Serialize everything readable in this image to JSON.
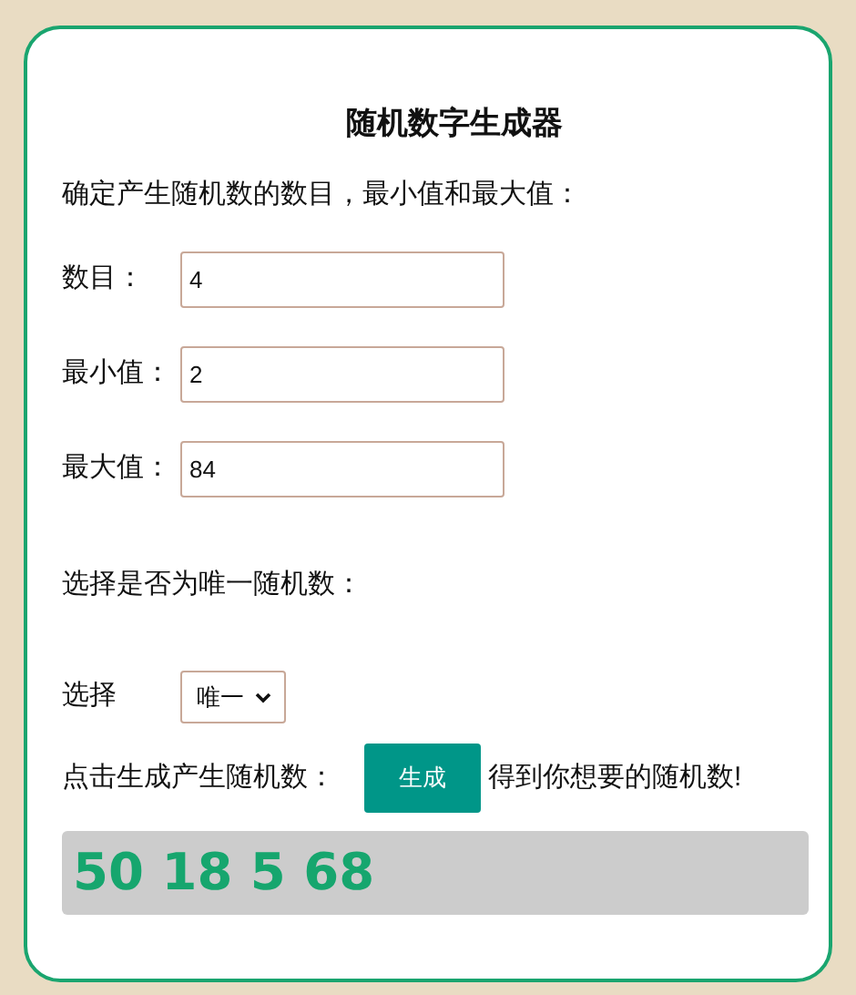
{
  "title": "随机数字生成器",
  "intro": "确定产生随机数的数目，最小值和最大值：",
  "fields": [
    {
      "label": "数目：",
      "value": "4"
    },
    {
      "label": "最小值：",
      "value": "2"
    },
    {
      "label": "最大值：",
      "value": "84"
    }
  ],
  "unique_prompt": "选择是否为唯一随机数：",
  "select": {
    "label": "选择",
    "value": "唯一"
  },
  "generate": {
    "prompt": "点击生成产生随机数：",
    "button": "生成",
    "suffix": "得到你想要的随机数!"
  },
  "result": "50 18 5 68"
}
